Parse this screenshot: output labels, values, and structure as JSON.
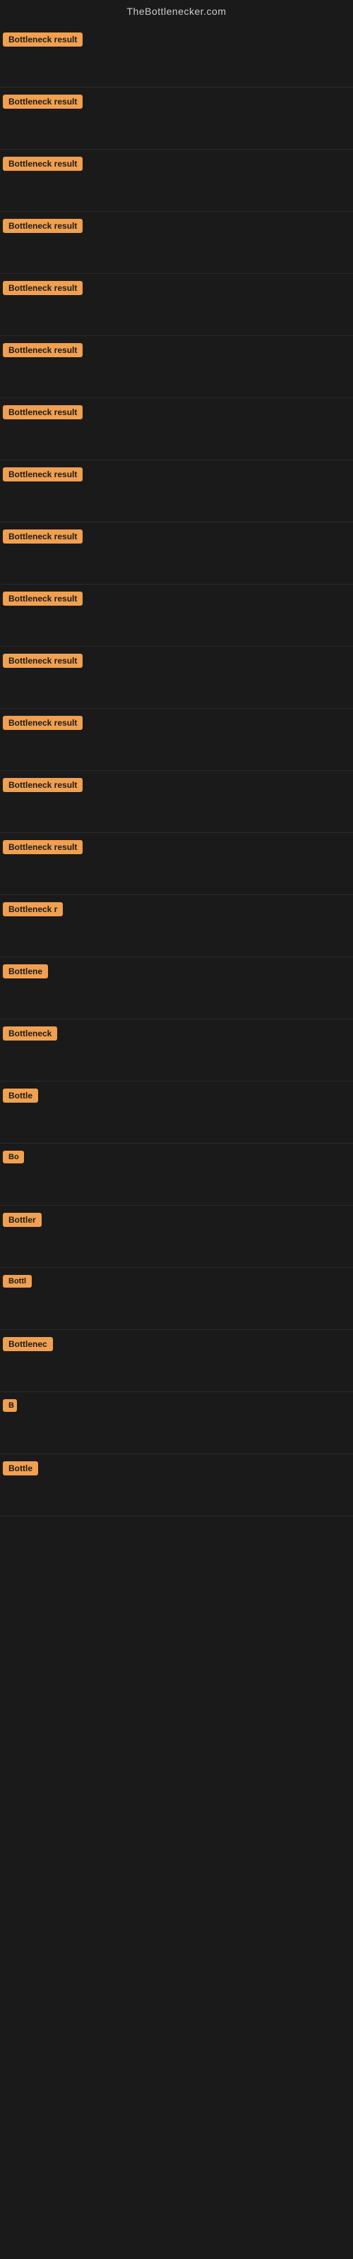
{
  "header": {
    "title": "TheBottlenecker.com"
  },
  "colors": {
    "badge_bg": "#f0a050",
    "page_bg": "#1a1a1a",
    "text_fg": "#cccccc"
  },
  "results": [
    {
      "id": 1,
      "label": "Bottleneck result",
      "width": 145
    },
    {
      "id": 2,
      "label": "Bottleneck result",
      "width": 145
    },
    {
      "id": 3,
      "label": "Bottleneck result",
      "width": 145
    },
    {
      "id": 4,
      "label": "Bottleneck result",
      "width": 145
    },
    {
      "id": 5,
      "label": "Bottleneck result",
      "width": 145
    },
    {
      "id": 6,
      "label": "Bottleneck result",
      "width": 145
    },
    {
      "id": 7,
      "label": "Bottleneck result",
      "width": 145
    },
    {
      "id": 8,
      "label": "Bottleneck result",
      "width": 145
    },
    {
      "id": 9,
      "label": "Bottleneck result",
      "width": 145
    },
    {
      "id": 10,
      "label": "Bottleneck result",
      "width": 145
    },
    {
      "id": 11,
      "label": "Bottleneck result",
      "width": 145
    },
    {
      "id": 12,
      "label": "Bottleneck result",
      "width": 130
    },
    {
      "id": 13,
      "label": "Bottleneck result",
      "width": 130
    },
    {
      "id": 14,
      "label": "Bottleneck result",
      "width": 120
    },
    {
      "id": 15,
      "label": "Bottleneck r",
      "width": 90
    },
    {
      "id": 16,
      "label": "Bottlene",
      "width": 72
    },
    {
      "id": 17,
      "label": "Bottleneck",
      "width": 80
    },
    {
      "id": 18,
      "label": "Bottle",
      "width": 58
    },
    {
      "id": 19,
      "label": "Bo",
      "width": 30
    },
    {
      "id": 20,
      "label": "Bottler",
      "width": 60
    },
    {
      "id": 21,
      "label": "Bottl",
      "width": 46
    },
    {
      "id": 22,
      "label": "Bottlenec",
      "width": 76
    },
    {
      "id": 23,
      "label": "B",
      "width": 20
    },
    {
      "id": 24,
      "label": "Bottle",
      "width": 58
    }
  ]
}
